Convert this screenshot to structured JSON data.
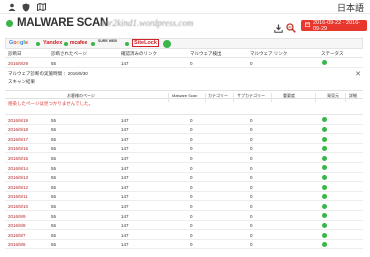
{
  "topnav": {
    "language": "日本語",
    "icons": [
      "user-icon",
      "shield-icon",
      "map-icon"
    ]
  },
  "header": {
    "title": "MALWARE SCAN",
    "domain": "dar2kind1.wordpress.com",
    "date_range": "2016-09-22 - 2016-09-29",
    "status_color": "#3bb54a"
  },
  "filters": {
    "logos": [
      "Google",
      "Yandex",
      "mcafee",
      "SURE WEB",
      "SiteLock"
    ],
    "active_color": "#3bb54a"
  },
  "table": {
    "headers": [
      "診断日",
      "診断されたページ",
      "確認済みのリンク",
      "マルウェア検出",
      "マルウェア リンク",
      "ステータス"
    ],
    "rows": [
      {
        "date": "2016/9/29",
        "pages": "55",
        "links": "147",
        "malware": "0",
        "mlinks": "0"
      },
      {
        "date": "2016/9/19",
        "pages": "55",
        "links": "147",
        "malware": "0",
        "mlinks": "0"
      },
      {
        "date": "2016/9/18",
        "pages": "55",
        "links": "147",
        "malware": "0",
        "mlinks": "0"
      },
      {
        "date": "2016/9/17",
        "pages": "55",
        "links": "147",
        "malware": "0",
        "mlinks": "0"
      },
      {
        "date": "2016/9/16",
        "pages": "55",
        "links": "147",
        "malware": "0",
        "mlinks": "0"
      },
      {
        "date": "2016/9/15",
        "pages": "55",
        "links": "147",
        "malware": "0",
        "mlinks": "0"
      },
      {
        "date": "2016/9/14",
        "pages": "55",
        "links": "147",
        "malware": "0",
        "mlinks": "0"
      },
      {
        "date": "2016/9/13",
        "pages": "55",
        "links": "147",
        "malware": "0",
        "mlinks": "0"
      },
      {
        "date": "2016/9/12",
        "pages": "55",
        "links": "147",
        "malware": "0",
        "mlinks": "0"
      },
      {
        "date": "2016/9/11",
        "pages": "55",
        "links": "147",
        "malware": "0",
        "mlinks": "0"
      },
      {
        "date": "2016/9/10",
        "pages": "55",
        "links": "147",
        "malware": "0",
        "mlinks": "0"
      },
      {
        "date": "2016/9/9",
        "pages": "55",
        "links": "147",
        "malware": "0",
        "mlinks": "0"
      },
      {
        "date": "2016/9/8",
        "pages": "55",
        "links": "147",
        "malware": "0",
        "mlinks": "0"
      },
      {
        "date": "2016/9/7",
        "pages": "55",
        "links": "147",
        "malware": "0",
        "mlinks": "0"
      },
      {
        "date": "2016/9/6",
        "pages": "55",
        "links": "147",
        "malware": "0",
        "mlinks": "0"
      }
    ]
  },
  "panel": {
    "last_scan": "マルウェア診断の実施時間 ：2016/9/30",
    "result_title": "スキャン結果",
    "sub_headers": [
      "お客様のページ",
      "Malware Scan",
      "カテゴリー",
      "サブカテゴリー",
      "重要度",
      "発見元",
      "詳細"
    ],
    "empty_message": "感染したページは見つかりませんでした。"
  }
}
